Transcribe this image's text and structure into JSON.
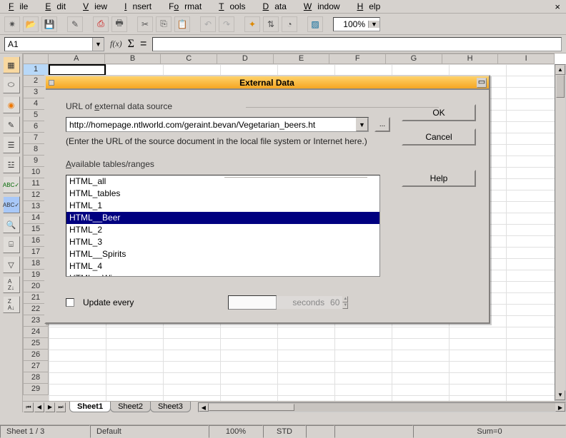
{
  "menu": {
    "file": "File",
    "edit": "Edit",
    "view": "View",
    "insert": "Insert",
    "format": "Format",
    "tools": "Tools",
    "data": "Data",
    "window": "Window",
    "help": "Help"
  },
  "zoom": "100%",
  "cellref": "A1",
  "fx_label": "f(x)",
  "columns": [
    "A",
    "B",
    "C",
    "D",
    "E",
    "F",
    "G",
    "H",
    "I"
  ],
  "rows": [
    "1",
    "2",
    "3",
    "4",
    "5",
    "6",
    "7",
    "8",
    "9",
    "10",
    "11",
    "12",
    "13",
    "14",
    "15",
    "16",
    "17",
    "18",
    "19",
    "20",
    "21",
    "22",
    "23",
    "24",
    "25",
    "26",
    "27",
    "28",
    "29"
  ],
  "tabs": {
    "s1": "Sheet1",
    "s2": "Sheet2",
    "s3": "Sheet3"
  },
  "status": {
    "sheet": "Sheet 1 / 3",
    "style": "Default",
    "zoom": "100%",
    "mode": "STD",
    "sel": "",
    "sum": "Sum=0"
  },
  "dialog": {
    "title": "External Data",
    "url_label": "URL of external data source",
    "url_value": "http://homepage.ntlworld.com/geraint.bevan/Vegetarian_beers.ht",
    "browse": "...",
    "hint": "(Enter the URL of the source document in the local file system or Internet here.)",
    "avail_label": "Available tables/ranges",
    "items": [
      "HTML_all",
      "HTML_tables",
      "HTML_1",
      "HTML__Beer",
      "HTML_2",
      "HTML_3",
      "HTML__Spirits",
      "HTML_4",
      "HTML__Wine"
    ],
    "selected_index": 3,
    "update_label": "Update every",
    "update_value": "60",
    "update_unit": "seconds",
    "ok": "OK",
    "cancel": "Cancel",
    "help": "Help"
  }
}
